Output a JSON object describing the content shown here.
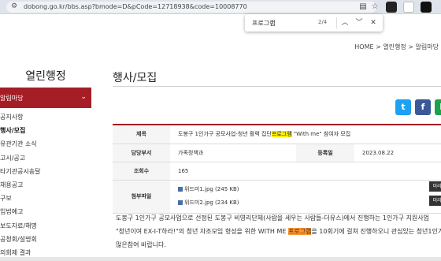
{
  "browser": {
    "url": "dobong.go.kr/bbs.asp?bmode=D&pCode=12718938&code=10008770"
  },
  "find_bar": {
    "query": "프로그램",
    "count": "2/4"
  },
  "breadcrumb": "HOME  >  열린행정  >  알림마당",
  "sidebar": {
    "title": "열린행정",
    "menu_head": "알림마당",
    "items": [
      "공지사항",
      "행사/모집",
      "유관기관 소식",
      "고시/공고",
      "타기관공시송달",
      "채용공고",
      "구보",
      "입법예고",
      "보도자료/해명",
      "공청회/설명회",
      "의회제 결과"
    ]
  },
  "page_title": "행사/모집",
  "share": [
    "t",
    "f",
    "k"
  ],
  "post": {
    "title_label": "제목",
    "title_pre": "도봉구 1인가구 공모사업-청년 활력 집단",
    "title_hl": "프로그램",
    "title_post": " \"With me\" 참여자 모집",
    "dept_label": "담당부서",
    "dept": "가족정책과",
    "date_label": "등록일",
    "date": "2023.08.22",
    "views_label": "조회수",
    "views": "165",
    "files_label": "첨부파일",
    "files": [
      "위드미1.jpg (245 KB)",
      "위드미2.jpg (234 KB)"
    ],
    "preview_label": "미리"
  },
  "body": {
    "line1": "도봉구 1인가구 공모사업으로 선정된 도봉구 비영리단체(사람을 세우는 사람들-더유스)에서  진행하는  1인가구 지원사업",
    "line2_pre": "\"청년이여 EX-I-T하라!\"의 청년 자조모임 형성을 위한 WITH ME ",
    "line2_hl": "프로그램",
    "line2_post": "을 10회기에 걸쳐 진행하오니 관심있는 청년1인가",
    "line3": "많은참여 바랍니다."
  }
}
